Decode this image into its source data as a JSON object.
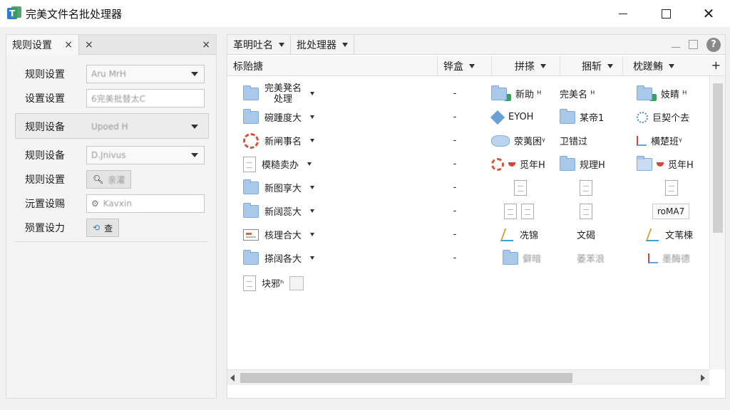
{
  "window": {
    "title": "完美文件名批处理器"
  },
  "left": {
    "tabs": [
      {
        "label": "规则设置",
        "close": "×"
      },
      {
        "label": "",
        "close": "×",
        "close2": "×"
      }
    ],
    "rows": [
      {
        "label": "规则设置",
        "type": "combo",
        "value": "Aru MrH"
      },
      {
        "label": "设置设置",
        "type": "text",
        "value": "6完美批替太C"
      },
      {
        "label": "规则设备",
        "type": "combo",
        "value": "Upoed H"
      },
      {
        "label": "规则设备",
        "type": "combo",
        "value": "D.Jnivus"
      },
      {
        "label": "规则设置",
        "type": "button",
        "value": "亲灌"
      },
      {
        "label": "沅置设赐",
        "type": "text",
        "value": "Kavxin"
      },
      {
        "label": "殒置设力",
        "type": "button",
        "value": "查"
      }
    ]
  },
  "right": {
    "toolbar": {
      "menu1": "革明吐名",
      "menu2": "批处理器",
      "help": "?"
    },
    "columns": [
      "标贻搪",
      "铧盒",
      "拼搽",
      "捆斩",
      "枕蹉鮪"
    ],
    "plus": "+",
    "rows": [
      {
        "name": "完美凳名",
        "name2": "处理",
        "icon": "folder",
        "dash": "-",
        "c3": "新助 ᴴ",
        "c3icon": "win-green",
        "c4": "完美名 ᴴ",
        "c4icon": "",
        "c5": "妓睛 ᴴ",
        "c5icon": "win-green"
      },
      {
        "name": "碗踵度大",
        "icon": "folder",
        "dash": "-",
        "c3": "EYOH",
        "c3icon": "diamond",
        "c4": "某帝1",
        "c4icon": "folder",
        "c5": "巨契个去",
        "c5icon": "star"
      },
      {
        "name": "新闸事名",
        "icon": "gear",
        "dash": "-",
        "c3": "荥荑困ᵞ",
        "c3icon": "hex",
        "c4": "卫错过",
        "c4icon": "",
        "c5": "横楚班ᵞ",
        "c5icon": "pin"
      },
      {
        "name": "模糙卖办",
        "icon": "doc",
        "dash": "-",
        "c3": "觅年H",
        "c3icon": "gear-red",
        "c4": "规理H",
        "c4icon": "folder",
        "c5": "觅年H",
        "c5icon": "x-red"
      },
      {
        "name": "新图享大",
        "icon": "folder",
        "dash": "-",
        "c3": "",
        "c3icon": "doc",
        "c4": "",
        "c4icon": "doc",
        "c5": "",
        "c5icon": "doc"
      },
      {
        "name": "新阔蕊大",
        "icon": "folder",
        "dash": "-",
        "c3": "",
        "c3icon": "doc2",
        "c4": "",
        "c4icon": "doc",
        "c5": "roMA7",
        "c5icon": "tag"
      },
      {
        "name": "核理合大",
        "icon": "win",
        "dash": "-",
        "c3": "冼锦",
        "c3icon": "tree",
        "c4": "文碣",
        "c4icon": "",
        "c5": "文苇楝",
        "c5icon": "tree"
      },
      {
        "name": "搽阔各大",
        "icon": "folder",
        "dash": "-",
        "c3": "僻暗",
        "c3icon": "folder",
        "c4": "萎苯浪",
        "c4icon": "",
        "c5": "墨酶德",
        "c5icon": "pin"
      },
      {
        "name": "块邪ʰ",
        "icon": "doc",
        "dash": "",
        "c3": "",
        "c3icon": "",
        "c4": "",
        "c4icon": "",
        "c5": "",
        "c5icon": "",
        "check": true
      }
    ]
  }
}
